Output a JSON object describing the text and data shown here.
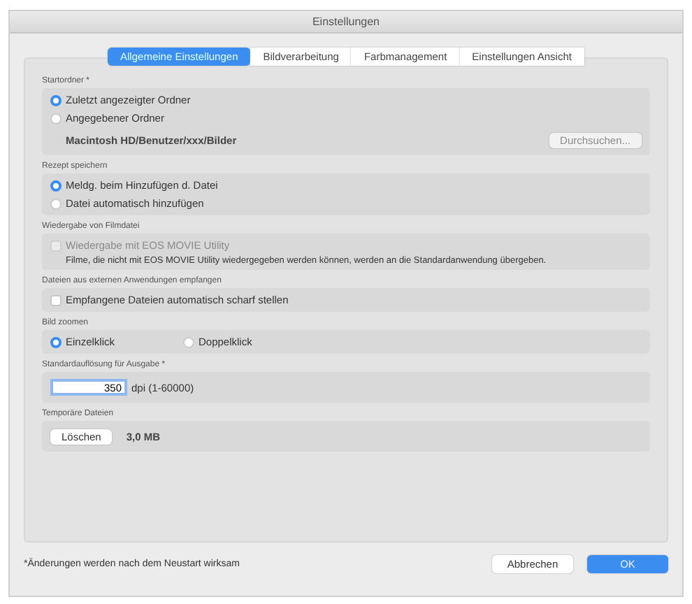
{
  "window": {
    "title": "Einstellungen"
  },
  "tabs": [
    {
      "label": "Allgemeine Einstellungen",
      "selected": true
    },
    {
      "label": "Bildverarbeitung",
      "selected": false
    },
    {
      "label": "Farbmanagement",
      "selected": false
    },
    {
      "label": "Einstellungen Ansicht",
      "selected": false
    }
  ],
  "sections": [
    {
      "label": "Startordner *",
      "items": [
        {
          "kind": "radio",
          "label": "Zuletzt angezeigter Ordner",
          "selected": true
        },
        {
          "kind": "radio",
          "label": "Angegebener Ordner",
          "selected": false
        },
        {
          "kind": "path",
          "text": "Macintosh HD/Benutzer/xxx/Bilder",
          "button": "Durchsuchen...",
          "button_disabled": true
        }
      ]
    },
    {
      "label": "Rezept speichern",
      "items": [
        {
          "kind": "radio",
          "label": "Meldg. beim Hinzufügen d. Datei",
          "selected": true
        },
        {
          "kind": "radio",
          "label": "Datei automatisch hinzufügen",
          "selected": false
        }
      ]
    },
    {
      "label": "Wiedergabe von Filmdatei",
      "items": [
        {
          "kind": "checkbox",
          "label": "Wiedergabe mit EOS MOVIE Utility",
          "checked": false,
          "disabled": true
        },
        {
          "kind": "note",
          "text": "Filme, die nicht mit EOS MOVIE Utility wiedergegeben werden können, werden an die Standardanwendung übergeben."
        }
      ]
    },
    {
      "label": "Dateien aus externen Anwendungen empfangen",
      "items": [
        {
          "kind": "checkbox",
          "label": "Empfangene Dateien automatisch scharf stellen",
          "checked": false,
          "disabled": false
        }
      ]
    },
    {
      "label": "Bild zoomen",
      "items": [
        {
          "kind": "radio-row",
          "options": [
            {
              "label": "Einzelklick",
              "selected": true
            },
            {
              "label": "Doppelklick",
              "selected": false
            }
          ]
        }
      ]
    },
    {
      "label": "Standardauflösung für Ausgabe *",
      "items": [
        {
          "kind": "number",
          "value": "350",
          "unit": "dpi (1-60000)"
        }
      ]
    },
    {
      "label": "Temporäre Dateien",
      "items": [
        {
          "kind": "action",
          "button": "Löschen",
          "text": "3,0 MB"
        }
      ]
    }
  ],
  "footer": {
    "note": "*Änderungen werden nach dem Neustart wirksam",
    "buttons": [
      {
        "label": "Abbrechen",
        "kind": "cancel"
      },
      {
        "label": "OK",
        "kind": "default"
      }
    ]
  }
}
